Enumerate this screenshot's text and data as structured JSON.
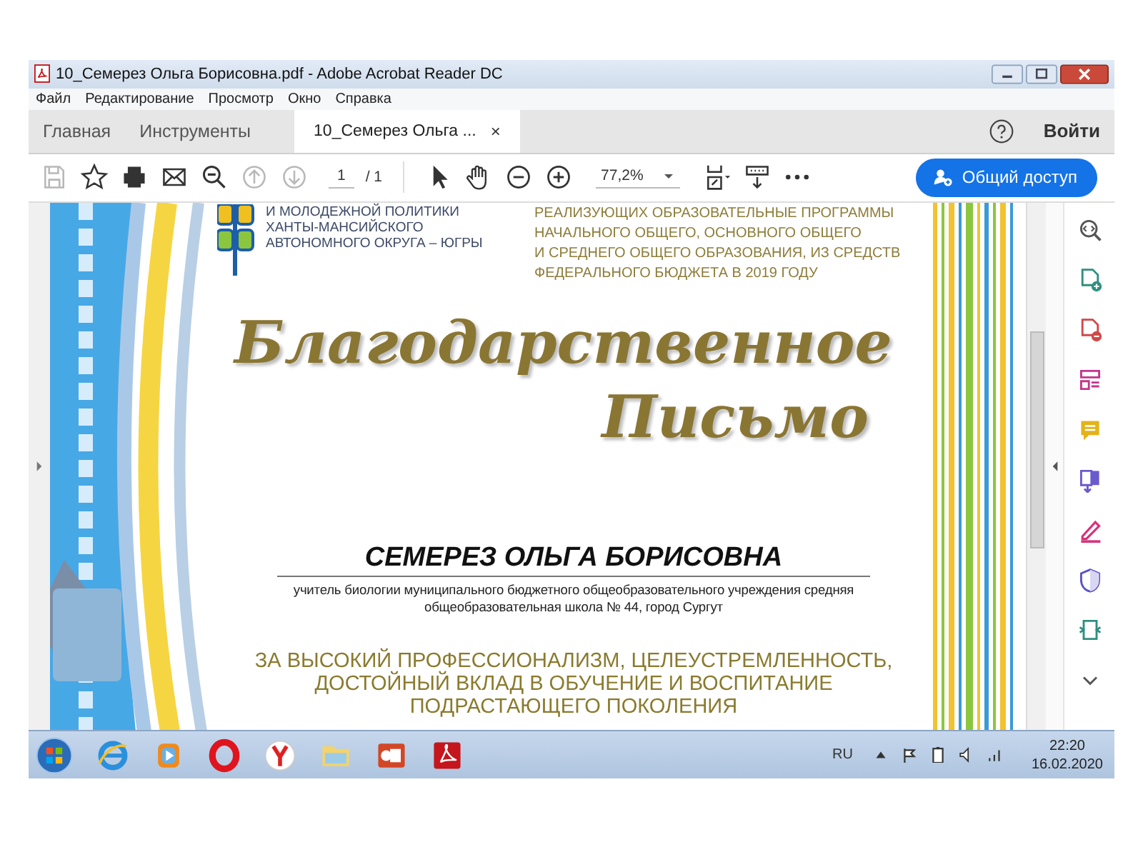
{
  "window": {
    "title": "10_Семерез Ольга Борисовна.pdf - Adobe Acrobat Reader DC"
  },
  "menu": [
    "Файл",
    "Редактирование",
    "Просмотр",
    "Окно",
    "Справка"
  ],
  "tabs": [
    {
      "label": "Главная",
      "selected": false
    },
    {
      "label": "Инструменты",
      "selected": false
    },
    {
      "label": "10_Семерез Ольга ...",
      "selected": true,
      "close": "×"
    }
  ],
  "sign_in": "Войти",
  "toolbar": {
    "left_tools": [
      {
        "kind": "save",
        "disabled": true
      },
      {
        "kind": "star",
        "disabled": false
      },
      {
        "kind": "print",
        "disabled": false
      },
      {
        "kind": "mail",
        "disabled": false
      },
      {
        "kind": "find",
        "disabled": false
      },
      {
        "kind": "up",
        "disabled": true
      },
      {
        "kind": "down",
        "disabled": true
      }
    ],
    "page": "1",
    "page_total": "/ 1",
    "right_tools": [
      {
        "kind": "pointer"
      },
      {
        "kind": "hand"
      },
      {
        "kind": "minus"
      },
      {
        "kind": "plus"
      }
    ],
    "zoom": "77,2%",
    "extra_tools": [
      {
        "kind": "fit"
      },
      {
        "kind": "scroll"
      },
      {
        "kind": "more"
      }
    ],
    "share_button": "Общий доступ"
  },
  "document": {
    "org_lines": [
      "И МОЛОДЕЖНОЙ ПОЛИТИКИ",
      "ХАНТЫ-МАНСИЙСКОГО",
      "АВТОНОМНОГО ОКРУГА – ЮГРЫ"
    ],
    "header_lines": [
      "РЕАЛИЗУЮЩИХ ОБРАЗОВАТЕЛЬНЫЕ ПРОГРАММЫ",
      "НАЧАЛЬНОГО ОБЩЕГО, ОСНОВНОГО ОБЩЕГО",
      "И СРЕДНЕГО ОБЩЕГО ОБРАЗОВАНИЯ, ИЗ СРЕДСТВ",
      "ФЕДЕРАЛЬНОГО БЮДЖЕТА В 2019 ГОДУ"
    ],
    "title_lines": [
      "Благодарственное",
      "Письмо"
    ],
    "name": "СЕМЕРЕЗ ОЛЬГА БОРИСОВНА",
    "position_lines": [
      "учитель биологии муниципального бюджетного общеобразовательного учреждения средняя",
      "общеобразовательная школа № 44, город Сургут"
    ],
    "merit_lines": [
      "ЗА ВЫСОКИЙ ПРОФЕССИОНАЛИЗМ, ЦЕЛЕУСТРЕМЛЕННОСТЬ,",
      "ДОСТОЙНЫЙ ВКЛАД В ОБУЧЕНИЕ И ВОСПИТАНИЕ",
      "ПОДРАСТАЮЩЕГО ПОКОЛЕНИЯ"
    ]
  },
  "tools_panel": [
    {
      "kind": "zoom-find"
    },
    {
      "kind": "create"
    },
    {
      "kind": "export"
    },
    {
      "kind": "organize"
    },
    {
      "kind": "comment"
    },
    {
      "kind": "combine"
    },
    {
      "kind": "sign"
    },
    {
      "kind": "protect"
    },
    {
      "kind": "compress"
    },
    {
      "kind": "chevron"
    }
  ],
  "taskbar": {
    "apps": [
      {
        "kind": "ie"
      },
      {
        "kind": "media"
      },
      {
        "kind": "opera"
      },
      {
        "kind": "yandex"
      },
      {
        "kind": "explorer"
      },
      {
        "kind": "powerpoint"
      },
      {
        "kind": "acrobat"
      }
    ],
    "language": "RU",
    "time": "22:20",
    "date": "16.02.2020"
  }
}
